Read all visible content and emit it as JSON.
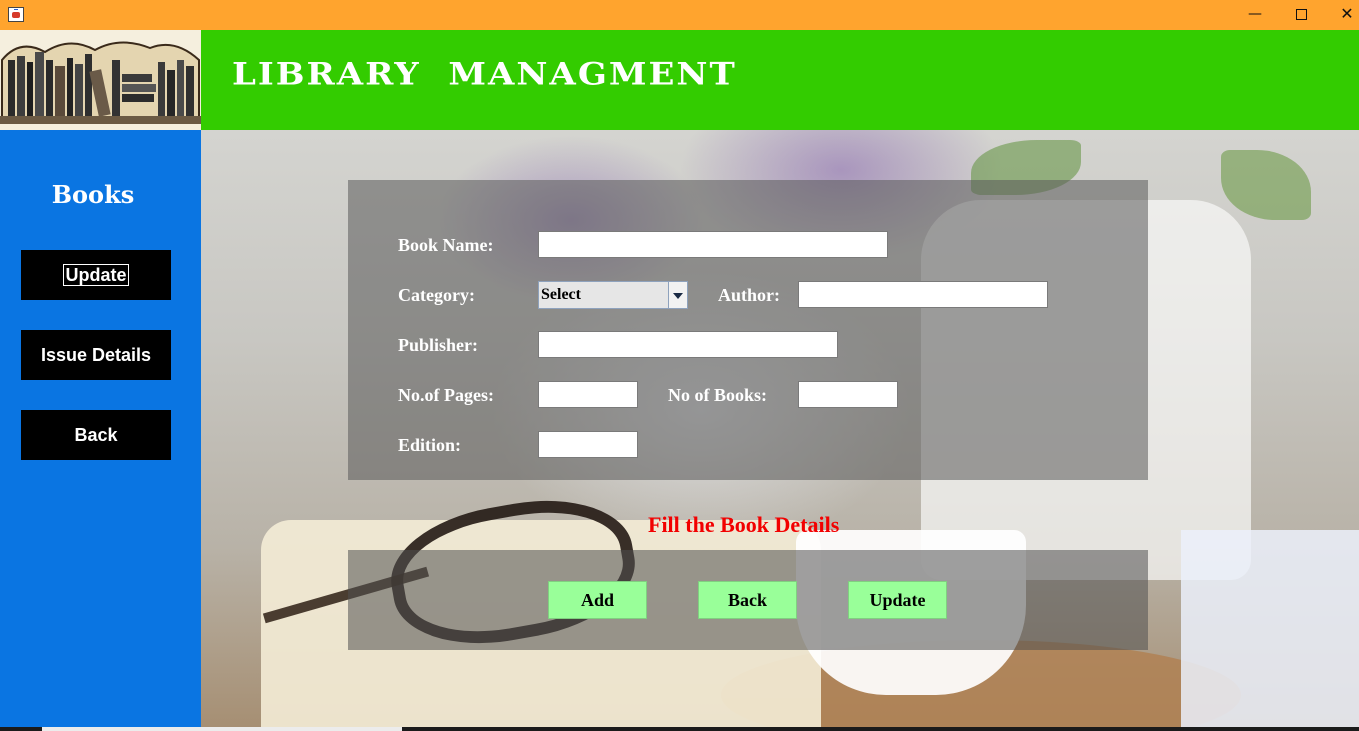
{
  "window": {
    "icon": "java-cup-icon",
    "controls": {
      "minimize": "—",
      "close": "✕"
    },
    "titlebar_color": "#ffa42e"
  },
  "header": {
    "title": "LIBRARY  MANAGMENT",
    "color": "#33cc00",
    "logo": "bookshelf-logo"
  },
  "sidebar": {
    "color": "#0a75e2",
    "title": "Books",
    "buttons": [
      {
        "label": "Update",
        "focused": true
      },
      {
        "label": "Issue Details"
      },
      {
        "label": "Back"
      }
    ]
  },
  "form": {
    "book_name": {
      "label": "Book Name:",
      "value": ""
    },
    "category": {
      "label": "Category:",
      "selected": "Select"
    },
    "author": {
      "label": "Author:",
      "value": ""
    },
    "publisher": {
      "label": "Publisher:",
      "value": ""
    },
    "pages": {
      "label": "No.of Pages:",
      "value": ""
    },
    "books": {
      "label": "No of Books:",
      "value": ""
    },
    "edition": {
      "label": "Edition:",
      "value": ""
    }
  },
  "message": {
    "text": "Fill the Book Details",
    "color": "#f20000"
  },
  "actions": {
    "add": "Add",
    "back": "Back",
    "update": "Update",
    "color": "#99ff99"
  }
}
